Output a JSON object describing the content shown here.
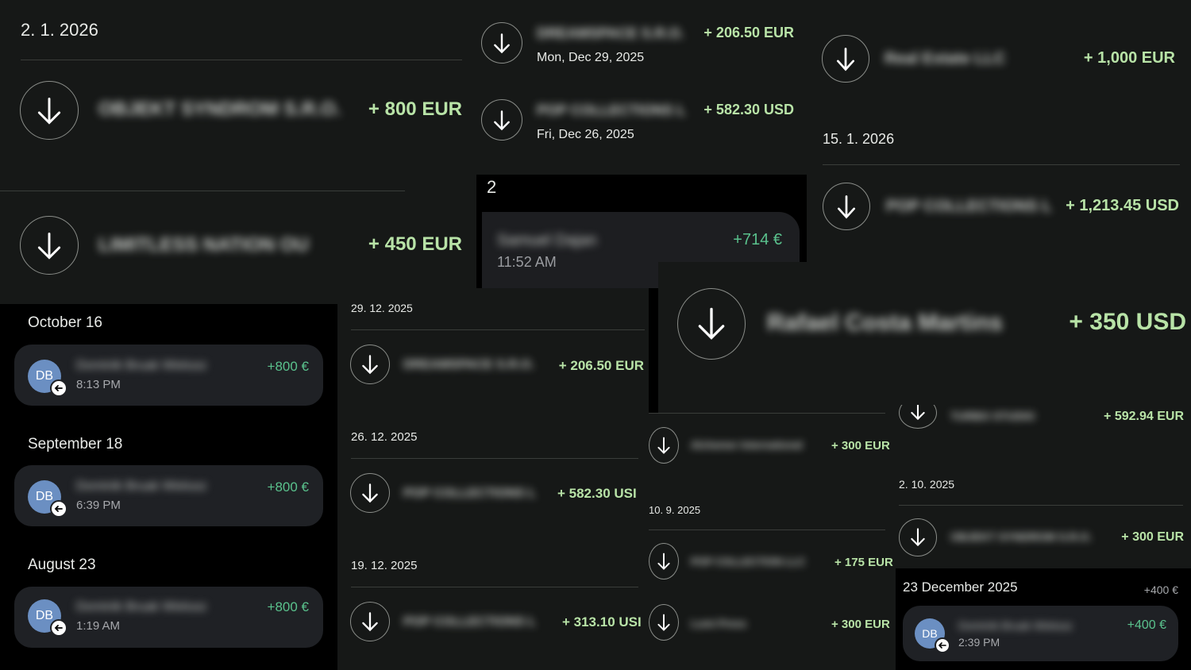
{
  "arrow_icon": "arrow-down-icon",
  "incoming_icon": "arrow-left-icon",
  "colors": {
    "amount_green": "#b8e3a7",
    "teal_amount": "#5ac28d",
    "panel_dark": "#161817",
    "card_bg": "#1f2125",
    "avatar_blue": "#6b8fc2"
  },
  "p1": {
    "date": "2. 1. 2026",
    "rows": [
      {
        "name": "OBJEKT SYNDROM S.R.O.",
        "amount": "+ 800 EUR"
      },
      {
        "name": "LIMITLESS NATION OU",
        "amount": "+ 450 EUR"
      }
    ]
  },
  "p2": {
    "rows": [
      {
        "name": "DREAMSPACE S.R.O.",
        "amount": "+ 206.50 EUR",
        "date": "Mon, Dec 29, 2025"
      },
      {
        "name": "POP COLLECTIONS L",
        "amount": "+ 582.30 USD",
        "date": "Fri, Dec 26, 2025"
      }
    ]
  },
  "p3": {
    "rows": [
      {
        "name": "Real Estate LLC",
        "amount": "+ 1,000 EUR"
      }
    ],
    "date": "15. 1. 2026",
    "rows2": [
      {
        "name": "POP COLLECTIONS L",
        "amount": "+ 1,213.45 USD"
      }
    ]
  },
  "p4": {
    "header": "2",
    "name": "Samuel Dajan",
    "amount": "+714 €",
    "time": "11:52 AM"
  },
  "p5": {
    "groups": [
      {
        "date": "October 16",
        "initials": "DB",
        "name": "Dominik Bruak Wielusz",
        "amount": "+800 €",
        "time": "8:13 PM"
      },
      {
        "date": "September 18",
        "initials": "DB",
        "name": "Dominik Bruak Wielusz",
        "amount": "+800 €",
        "time": "6:39 PM"
      },
      {
        "date": "August 23",
        "initials": "DB",
        "name": "Dominik Bruak Wielusz",
        "amount": "+800 €",
        "time": "1:19 AM"
      }
    ]
  },
  "p6": {
    "top_date": "29. 12. 2025",
    "rows": [
      {
        "name": "DREAMSPACE S.R.O.",
        "amount": "+ 206.50 EUR"
      }
    ],
    "date2": "26. 12. 2025",
    "rows2": [
      {
        "name": "POP COLLECTIONS L",
        "amount": "+ 582.30 USI"
      }
    ],
    "date3": "19. 12. 2025",
    "rows3": [
      {
        "name": "POP COLLECTIONS L",
        "amount": "+ 313.10 USI"
      }
    ]
  },
  "p7": {
    "name": "Rafael Costa Martins",
    "amount": "+ 350 USD"
  },
  "p8": {
    "rows": [
      {
        "name": "Alchemer International",
        "amount": "+ 300 EUR"
      }
    ],
    "date": "10. 9. 2025",
    "rows2": [
      {
        "name": "POP COLLECTION LLC",
        "amount": "+ 175 EUR"
      },
      {
        "name": "Lumi Press",
        "amount": "+ 300 EUR"
      }
    ]
  },
  "p9": {
    "rows": [
      {
        "name": "TURBO STUDIO",
        "amount": "+ 592.94 EUR"
      }
    ],
    "date": "2. 10. 2025",
    "rows2": [
      {
        "name": "OBJEKT SYNDROM S.R.O.",
        "amount": "+ 300 EUR"
      }
    ]
  },
  "p10": {
    "date": "23 December 2025",
    "total": "+400 €",
    "initials": "DB",
    "name": "Dominik Bruak Wielusz",
    "amount": "+400 €",
    "time": "2:39 PM"
  }
}
